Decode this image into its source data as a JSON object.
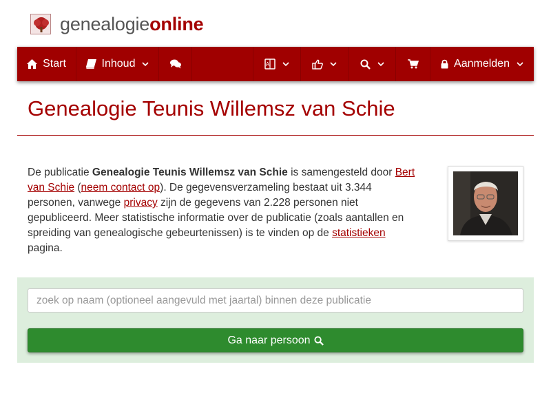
{
  "header": {
    "logo_part1": "genealogie",
    "logo_part2": "online"
  },
  "nav": {
    "items": [
      {
        "label": "Start",
        "icon": "home-icon"
      },
      {
        "label": "Inhoud",
        "icon": "book-icon"
      },
      {
        "label": "",
        "icon": "comments-icon"
      },
      {
        "label": "",
        "icon": "language-icon"
      },
      {
        "label": "",
        "icon": "thumbs-up-icon"
      },
      {
        "label": "",
        "icon": "search-icon"
      },
      {
        "label": "",
        "icon": "cart-icon"
      },
      {
        "label": "Aanmelden",
        "icon": "lock-icon"
      }
    ]
  },
  "page": {
    "title": "Genealogie Teunis Willemsz van Schie"
  },
  "intro": {
    "t1": "De publicatie ",
    "pub_name": "Genealogie Teunis Willemsz van Schie",
    "t2": " is samengesteld door ",
    "author_link": "Bert van Schie",
    "t3": " (",
    "contact_link": "neem contact op",
    "t4": "). De gegevensverzameling bestaat uit 3.344 personen, vanwege ",
    "privacy_link": "privacy",
    "t5": " zijn de gegevens van 2.228 personen niet gepubliceerd. Meer statistische informatie over de publicatie (zoals aantallen en spreiding van genealogische gebeurtenissen) is te vinden op de ",
    "stats_link": "statistieken",
    "t6": " pagina."
  },
  "search": {
    "placeholder": "zoek op naam (optioneel aangevuld met jaartal) binnen deze publicatie",
    "button_label": "Ga naar persoon"
  },
  "colors": {
    "brand": "#a40000",
    "nav_bg": "#a00000",
    "search_bg": "#ddeedd",
    "button_green": "#2e8b2e"
  }
}
